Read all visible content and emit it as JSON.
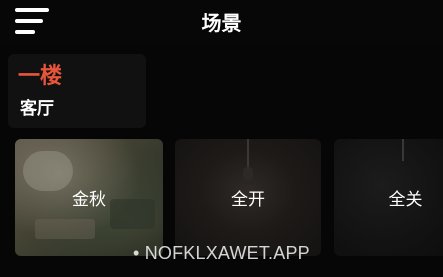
{
  "header": {
    "title": "场景",
    "menu_icon": "hamburger-menu-icon"
  },
  "room": {
    "floor": "一楼",
    "name": "客厅",
    "floor_color": "#e8553a"
  },
  "scenes": [
    {
      "label": "金秋"
    },
    {
      "label": "全开"
    },
    {
      "label": "全关"
    }
  ],
  "watermark": "• NOFKLXAWET.APP"
}
